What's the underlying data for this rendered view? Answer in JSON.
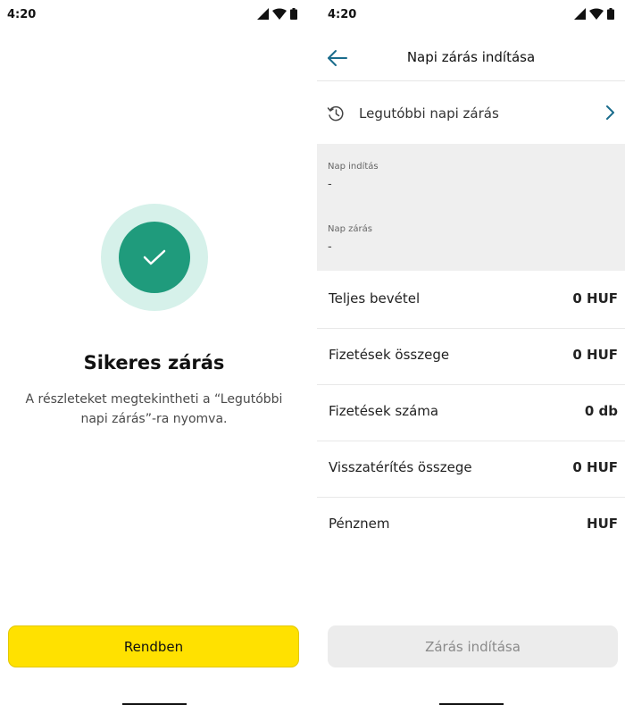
{
  "status_bar": {
    "time": "4:20"
  },
  "success_screen": {
    "title": "Sikeres zárás",
    "description": "A részleteket megtekintheti a “Legutóbbi napi zárás”-ra nyomva.",
    "ok_button": "Rendben"
  },
  "closing_screen": {
    "title": "Napi zárás indítása",
    "recent_closing": "Legutóbbi napi zárás",
    "day_start": {
      "label": "Nap indítás",
      "value": "-"
    },
    "day_close": {
      "label": "Nap zárás",
      "value": "-"
    },
    "rows": [
      {
        "label": "Teljes bevétel",
        "value": "0 HUF"
      },
      {
        "label": "Fizetések összege",
        "value": "0 HUF"
      },
      {
        "label": "Fizetések száma",
        "value": "0 db"
      },
      {
        "label": "Visszatérítés összege",
        "value": "0 HUF"
      },
      {
        "label": "Pénznem",
        "value": "HUF"
      }
    ],
    "start_button": "Zárás indítása"
  },
  "colors": {
    "accent_yellow": "#ffe100",
    "success_green": "#1f9b7c",
    "success_green_light": "#d6f1ea",
    "back_arrow": "#1a6c8c",
    "chevron": "#1a6c8c"
  },
  "icons": [
    "signal-icon",
    "wifi-icon",
    "battery-icon",
    "checkmark-icon",
    "back-arrow-icon",
    "history-icon",
    "chevron-right-icon"
  ]
}
